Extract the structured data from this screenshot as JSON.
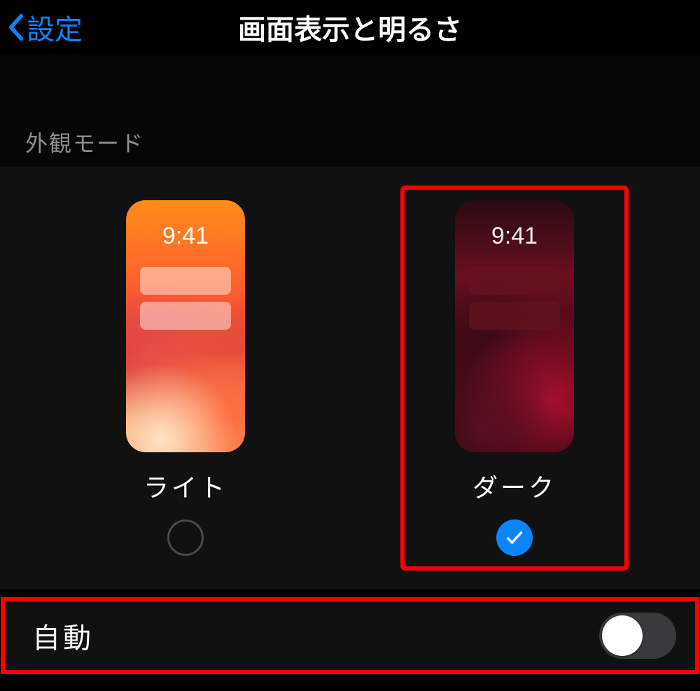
{
  "navbar": {
    "back_label": "設定",
    "title": "画面表示と明るさ"
  },
  "section_header": "外観モード",
  "appearance": {
    "preview_time": "9:41",
    "options": [
      {
        "label": "ライト",
        "selected": false,
        "highlighted": false
      },
      {
        "label": "ダーク",
        "selected": true,
        "highlighted": true
      }
    ]
  },
  "auto": {
    "label": "自動",
    "enabled": false,
    "highlighted": true
  },
  "colors": {
    "accent": "#0a84ff",
    "highlight": "#ff0000"
  }
}
